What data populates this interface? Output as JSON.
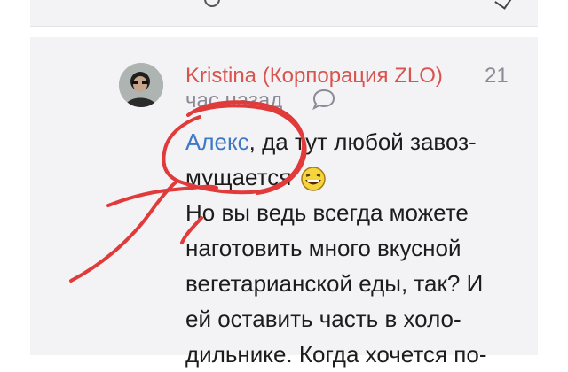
{
  "comment": {
    "author": "Kristina (Корпорация ZLO)",
    "time_number": "21",
    "time_unit": "час назад",
    "mention": "Алекс",
    "lines": [
      ", да тут любой завоз-",
      "мущается",
      "Но вы ведь всегда можете",
      "наготовить много вкусной",
      "вегетарианской еды, так? И",
      "ей оставить часть в холо-",
      "дильнике. Когда хочется по-"
    ],
    "emoji": "laughing-emoji"
  },
  "colors": {
    "author": "#d9534f",
    "mention": "#3f79c6",
    "muted": "#8b8b96",
    "annotation": "#e03a3a"
  },
  "icons": {
    "reply": "speech-bubble-icon"
  }
}
